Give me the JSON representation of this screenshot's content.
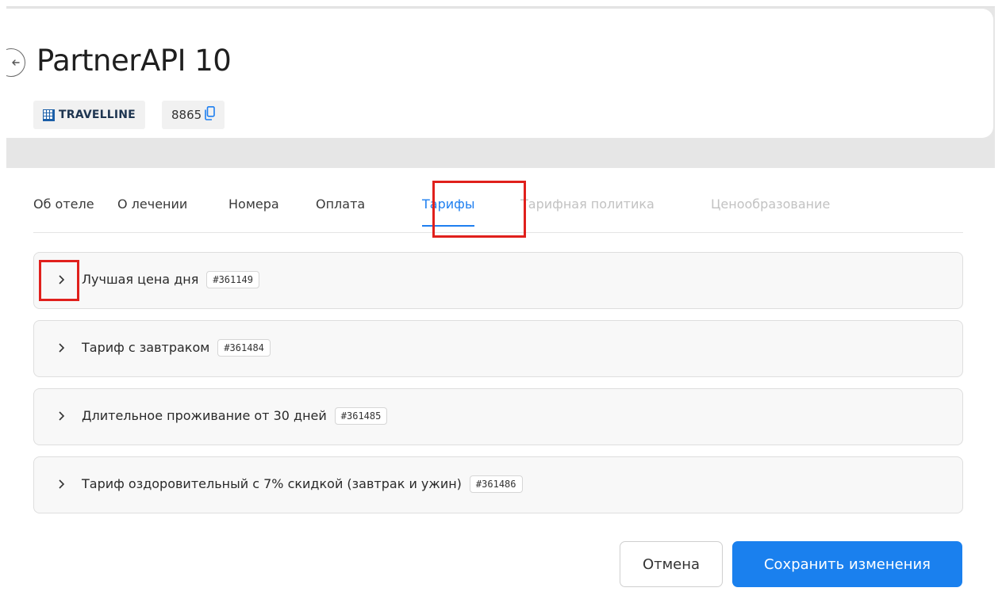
{
  "hotel": {
    "name": "PartnerAPI 10",
    "brand": "TRAVELLINE",
    "id": "8865"
  },
  "icons": {
    "back": "arrow-left-icon",
    "brand": "travelline-logo-icon",
    "copy": "copy-icon",
    "expand": "chevron-right-icon"
  },
  "tabs": [
    {
      "label": "Об отеле",
      "state": "normal"
    },
    {
      "label": "О лечении",
      "state": "normal"
    },
    {
      "label": "Номера",
      "state": "normal"
    },
    {
      "label": "Оплата",
      "state": "normal"
    },
    {
      "label": "Тарифы",
      "state": "active"
    },
    {
      "label": "Тарифная политика",
      "state": "disabled"
    },
    {
      "label": "Ценообразование",
      "state": "disabled"
    }
  ],
  "tariffs": [
    {
      "name": "Лучшая цена дня",
      "code": "#361149"
    },
    {
      "name": "Тариф с завтраком",
      "code": "#361484"
    },
    {
      "name": "Длительное проживание от 30 дней",
      "code": "#361485"
    },
    {
      "name": "Тариф оздоровительный с 7% скидкой (завтрак и ужин)",
      "code": "#361486"
    }
  ],
  "actions": {
    "cancel": "Отмена",
    "save": "Сохранить изменения"
  },
  "colors": {
    "accent": "#1a80ee",
    "highlight": "#e0201c",
    "disabled_tab": "#c2c2c2"
  }
}
